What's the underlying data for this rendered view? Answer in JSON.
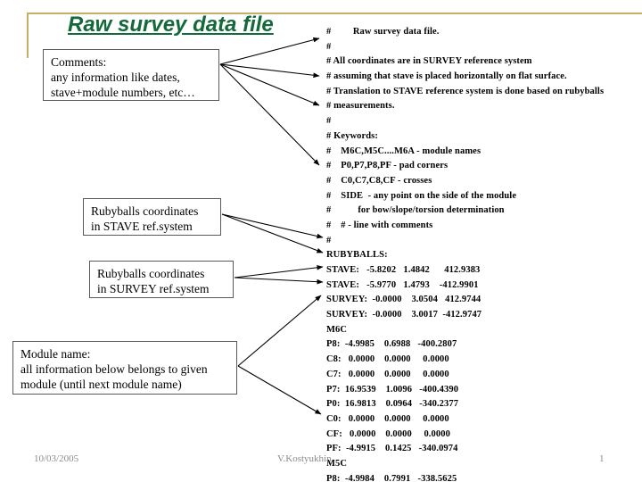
{
  "slide": {
    "title": "Raw survey data file",
    "accent_color": "#c9ad62",
    "title_color": "#14693b"
  },
  "callouts": {
    "comments": {
      "line1": "Comments:",
      "line2": "any information like dates,",
      "line3": "stave+module numbers, etc…"
    },
    "ruby_stave": {
      "line1": "Rubyballs coordinates",
      "line2": "in STAVE ref.system"
    },
    "ruby_survey": {
      "line1": "Rubyballs coordinates",
      "line2": "in SURVEY ref.system"
    },
    "module": {
      "line1": "Module name:",
      "line2": "all information below belongs to given",
      "line3": "module (until next module name)"
    }
  },
  "listing": {
    "lines": [
      "#         Raw survey data file.",
      "#",
      "# All coordinates are in SURVEY reference system",
      "# assuming that stave is placed horizontally on flat surface.",
      "# Translation to STAVE reference system is done based on rubyballs",
      "# measurements.",
      "#",
      "# Keywords:",
      "#    M6C,M5C....M6A - module names",
      "#    P0,P7,P8,PF - pad corners",
      "#    C0,C7,C8,CF - crosses",
      "#    SIDE  - any point on the side of the module",
      "#           for bow/slope/torsion determination",
      "#    # - line with comments",
      "#",
      "RUBYBALLS:",
      "STAVE:   -5.8202   1.4842      412.9383",
      "STAVE:   -5.9770   1.4793    -412.9901",
      "SURVEY:  -0.0000    3.0504   412.9744",
      "SURVEY:  -0.0000    3.0017  -412.9747",
      "M6C",
      "P8:  -4.9985    0.6988   -400.2807",
      "C8:   0.0000    0.0000     0.0000",
      "C7:   0.0000    0.0000     0.0000",
      "P7:  16.9539    1.0096   -400.4390",
      "P0:  16.9813    0.0964   -340.2377",
      "C0:   0.0000    0.0000     0.0000",
      "CF:   0.0000    0.0000     0.0000",
      "PF:  -4.9915    0.1425   -340.0974",
      "M5C",
      "P8:  -4.9984    0.7991   -338.5625"
    ]
  },
  "footer": {
    "date": "10/03/2005",
    "author": "V.Kostyukhin",
    "page": "1"
  }
}
